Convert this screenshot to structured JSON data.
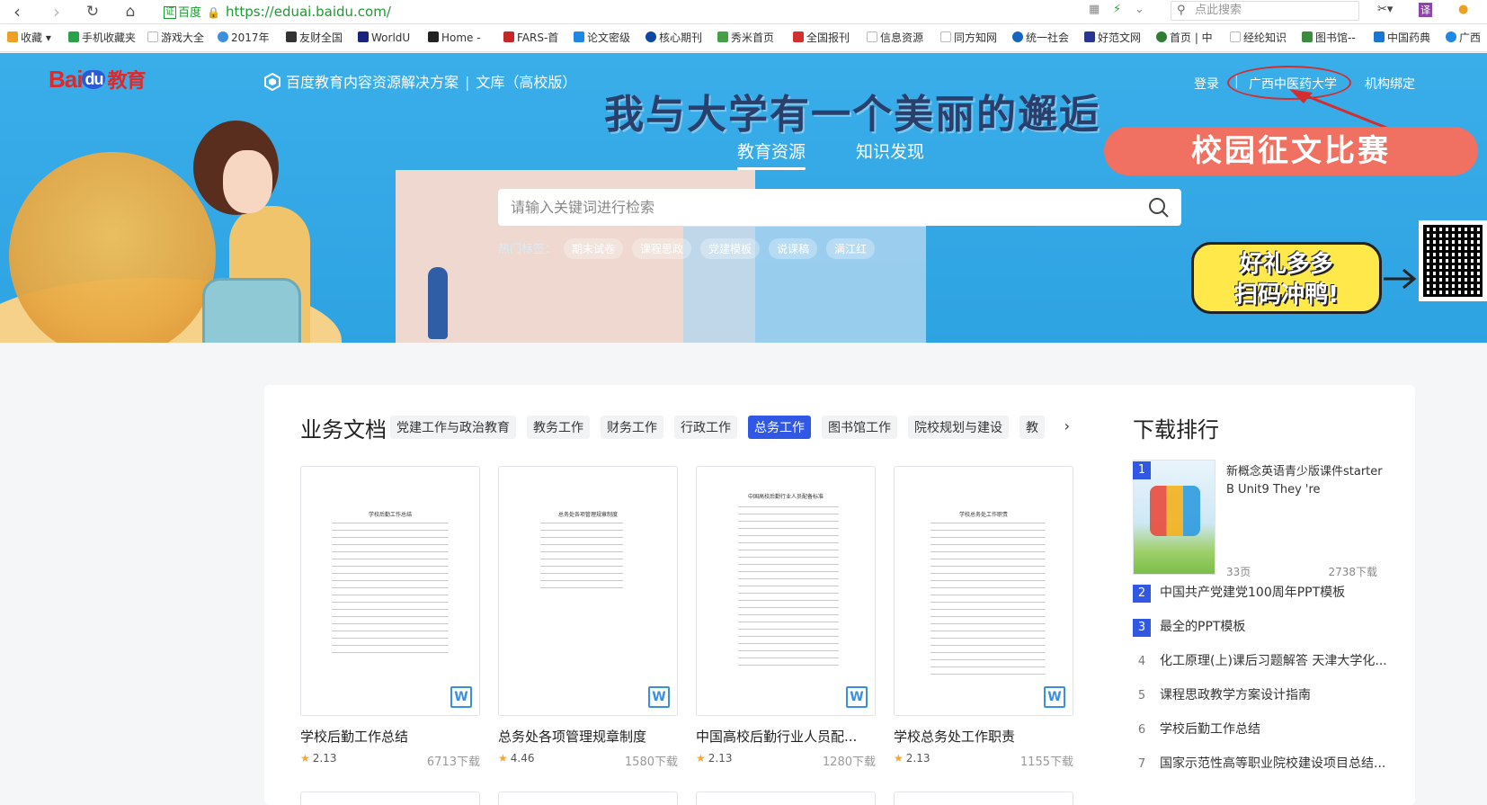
{
  "browser": {
    "cert_label": "证",
    "site_label": "百度",
    "url": "https://eduai.baidu.com/",
    "search_placeholder": "点此搜索"
  },
  "bookmarks": [
    {
      "label": "收藏",
      "color": "#f0a020"
    },
    {
      "label": "手机收藏夹",
      "color": "#2aa14b"
    },
    {
      "label": "游戏大全",
      "color": "#cccccc"
    },
    {
      "label": "2017年",
      "color": "#3a8fe0"
    },
    {
      "label": "友财全国",
      "color": "#333333"
    },
    {
      "label": "WorldU",
      "color": "#1a237e"
    },
    {
      "label": "Home -",
      "color": "#222222"
    },
    {
      "label": "FARS-首",
      "color": "#c62828"
    },
    {
      "label": "论文密级",
      "color": "#1e88e5"
    },
    {
      "label": "核心期刊",
      "color": "#0d47a1"
    },
    {
      "label": "秀米首页",
      "color": "#43a047"
    },
    {
      "label": "全国报刊",
      "color": "#d32f2f"
    },
    {
      "label": "信息资源",
      "color": "#cccccc"
    },
    {
      "label": "同方知网",
      "color": "#cccccc"
    },
    {
      "label": "统一社会",
      "color": "#1565c0"
    },
    {
      "label": "好范文网",
      "color": "#283593"
    },
    {
      "label": "首页 | 中",
      "color": "#2e7d32"
    },
    {
      "label": "经纶知识",
      "color": "#cccccc"
    },
    {
      "label": "图书馆--",
      "color": "#388e3c"
    },
    {
      "label": "中国药典",
      "color": "#1976d2"
    },
    {
      "label": "广西",
      "color": "#1e88e5"
    }
  ],
  "hero": {
    "logo_bai": "Bai",
    "logo_du": "du",
    "logo_edu": "教育",
    "brand_title": "百度教育内容资源解决方案",
    "brand_sub": "文库（高校版）",
    "slogan": "我与大学有一个美丽的邂逅",
    "tabs": [
      "教育资源",
      "知识发现"
    ],
    "search_placeholder": "请输入关键词进行检索",
    "hot_label": "热门标签：",
    "hot_tags": [
      "期末试卷",
      "课程思政",
      "党建模板",
      "说课稿",
      "满江红"
    ],
    "login": "登录",
    "university": "广西中医药大学",
    "bind": "机构绑定",
    "contest": "校园征文比赛",
    "gift_line1": "好礼多多",
    "gift_line2": "扫码冲鸭!"
  },
  "business": {
    "title": "业务文档",
    "categories": [
      "党建工作与政治教育",
      "教务工作",
      "财务工作",
      "行政工作",
      "总务工作",
      "图书馆工作",
      "院校规划与建设",
      "教"
    ],
    "active_category": "总务工作",
    "docs": [
      {
        "title": "学校后勤工作总结",
        "rating": "2.13",
        "downloads": "6713下载",
        "page_heading": "学校后勤工作总结"
      },
      {
        "title": "总务处各项管理规章制度",
        "rating": "4.46",
        "downloads": "1580下载",
        "page_heading": "总务处各项管理规章制度"
      },
      {
        "title": "中国高校后勤行业人员配...",
        "rating": "2.13",
        "downloads": "1280下载",
        "page_heading": "中国高校后勤行业人员配备标准"
      },
      {
        "title": "学校总务处工作职责",
        "rating": "2.13",
        "downloads": "1155下载",
        "page_heading": "学校总务处工作职责"
      }
    ]
  },
  "ranking": {
    "title": "下载排行",
    "top": {
      "rank": "1",
      "title": "新概念英语青少版课件starter B Unit9 They 're",
      "pages": "33页",
      "downloads": "2738下载"
    },
    "items": [
      {
        "rank": "2",
        "title": "中国共产党建党100周年PPT模板",
        "highlight": true
      },
      {
        "rank": "3",
        "title": "最全的PPT模板",
        "highlight": true
      },
      {
        "rank": "4",
        "title": "化工原理(上)课后习题解答 天津大学化...",
        "highlight": false
      },
      {
        "rank": "5",
        "title": "课程思政教学方案设计指南",
        "highlight": false
      },
      {
        "rank": "6",
        "title": "学校后勤工作总结",
        "highlight": false
      },
      {
        "rank": "7",
        "title": "国家示范性高等职业院校建设项目总结...",
        "highlight": false
      }
    ]
  }
}
